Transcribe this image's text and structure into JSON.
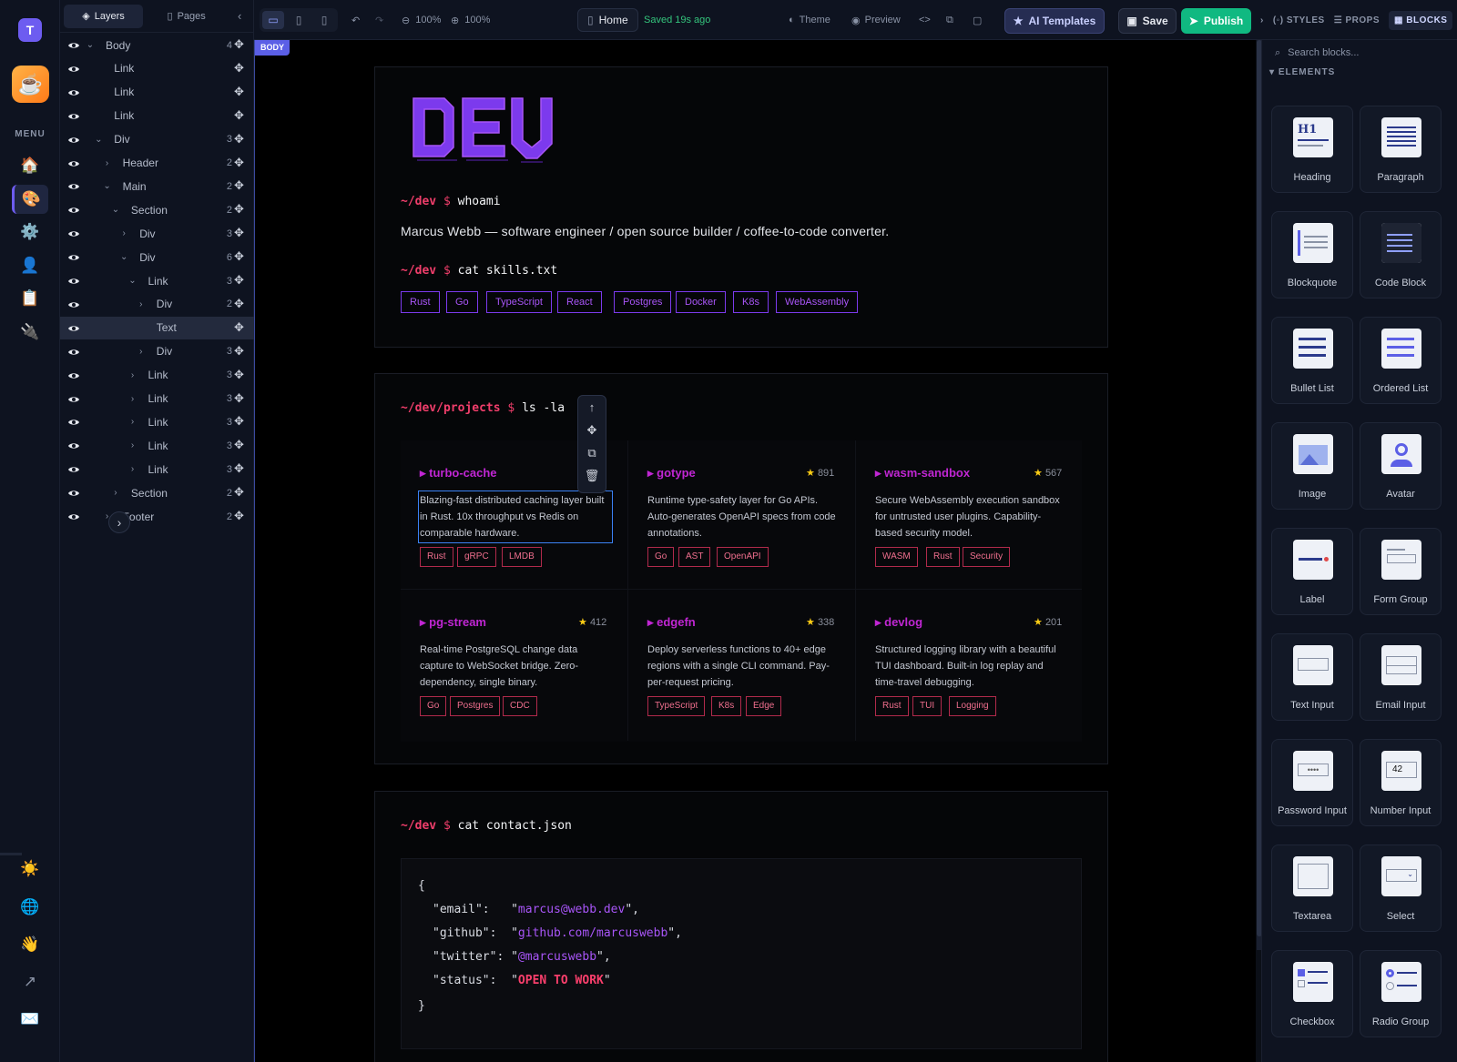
{
  "rail": {
    "logo": "T",
    "menu_label": "MENU",
    "items": [
      {
        "icon": "home-icon",
        "glyph": "🏠"
      },
      {
        "icon": "palette-icon",
        "glyph": "🎨"
      },
      {
        "icon": "gear-icon",
        "glyph": "⚙️"
      },
      {
        "icon": "user-icon",
        "glyph": "👤"
      },
      {
        "icon": "clipboard-icon",
        "glyph": "📋"
      },
      {
        "icon": "plug-icon",
        "glyph": "🔌"
      }
    ],
    "bottom": [
      {
        "icon": "sun-icon",
        "glyph": "☀️"
      },
      {
        "icon": "globe-icon",
        "glyph": "🌐"
      },
      {
        "icon": "wave-icon",
        "glyph": "👋"
      },
      {
        "icon": "external-arrow-icon",
        "glyph": "↗"
      },
      {
        "icon": "mail-icon",
        "glyph": "✉️"
      }
    ]
  },
  "layers_panel": {
    "tabs": {
      "layers": "Layers",
      "pages": "Pages"
    },
    "rows": [
      {
        "name": "Body",
        "depth": 0,
        "chev": "⌄",
        "count": "4"
      },
      {
        "name": "Link",
        "depth": 1,
        "chev": "",
        "count": ""
      },
      {
        "name": "Link",
        "depth": 1,
        "chev": "",
        "count": ""
      },
      {
        "name": "Link",
        "depth": 1,
        "chev": "",
        "count": ""
      },
      {
        "name": "Div",
        "depth": 1,
        "chev": "⌄",
        "count": "3"
      },
      {
        "name": "Header",
        "depth": 2,
        "chev": "›",
        "count": "2"
      },
      {
        "name": "Main",
        "depth": 2,
        "chev": "⌄",
        "count": "2"
      },
      {
        "name": "Section",
        "depth": 3,
        "chev": "⌄",
        "count": "2"
      },
      {
        "name": "Div",
        "depth": 4,
        "chev": "›",
        "count": "3"
      },
      {
        "name": "Div",
        "depth": 4,
        "chev": "⌄",
        "count": "6"
      },
      {
        "name": "Link",
        "depth": 5,
        "chev": "⌄",
        "count": "3"
      },
      {
        "name": "Div",
        "depth": 6,
        "chev": "›",
        "count": "2"
      },
      {
        "name": "Text",
        "depth": 6,
        "chev": "",
        "count": "",
        "selected": true
      },
      {
        "name": "Div",
        "depth": 6,
        "chev": "›",
        "count": "3"
      },
      {
        "name": "Link",
        "depth": 5,
        "chev": "›",
        "count": "3"
      },
      {
        "name": "Link",
        "depth": 5,
        "chev": "›",
        "count": "3"
      },
      {
        "name": "Link",
        "depth": 5,
        "chev": "›",
        "count": "3"
      },
      {
        "name": "Link",
        "depth": 5,
        "chev": "›",
        "count": "3"
      },
      {
        "name": "Link",
        "depth": 5,
        "chev": "›",
        "count": "3"
      },
      {
        "name": "Section",
        "depth": 3,
        "chev": "›",
        "count": "2"
      },
      {
        "name": "Footer",
        "depth": 2,
        "chev": "›",
        "count": "2"
      }
    ]
  },
  "toolbar": {
    "zoom_out": "100%",
    "zoom_in": "100%",
    "page_name": "Home",
    "saved_status": "Saved 19s ago",
    "theme": "Theme",
    "preview": "Preview",
    "ai_templates": "AI Templates",
    "save": "Save",
    "publish": "Publish",
    "right_tabs": {
      "styles": "STYLES",
      "props": "PROPS",
      "blocks": "BLOCKS"
    }
  },
  "blocks_panel": {
    "search_placeholder": "Search blocks...",
    "section_label": "ELEMENTS",
    "items": [
      {
        "label": "Heading",
        "icon": "heading-block-icon"
      },
      {
        "label": "Paragraph",
        "icon": "paragraph-block-icon"
      },
      {
        "label": "Blockquote",
        "icon": "blockquote-block-icon"
      },
      {
        "label": "Code Block",
        "icon": "code-block-icon"
      },
      {
        "label": "Bullet List",
        "icon": "bullet-list-icon"
      },
      {
        "label": "Ordered List",
        "icon": "ordered-list-icon"
      },
      {
        "label": "Image",
        "icon": "image-block-icon"
      },
      {
        "label": "Avatar",
        "icon": "avatar-block-icon"
      },
      {
        "label": "Label",
        "icon": "label-block-icon"
      },
      {
        "label": "Form Group",
        "icon": "form-group-icon"
      },
      {
        "label": "Text Input",
        "icon": "text-input-icon"
      },
      {
        "label": "Email Input",
        "icon": "email-input-icon"
      },
      {
        "label": "Password Input",
        "icon": "password-input-icon"
      },
      {
        "label": "Number Input",
        "icon": "number-input-icon",
        "value": "42"
      },
      {
        "label": "Textarea",
        "icon": "textarea-icon"
      },
      {
        "label": "Select",
        "icon": "select-icon"
      },
      {
        "label": "Checkbox",
        "icon": "checkbox-icon"
      },
      {
        "label": "Radio Group",
        "icon": "radio-group-icon"
      }
    ]
  },
  "canvas": {
    "body_tag": "BODY",
    "hero": {
      "logo_text": "DEV",
      "prompt1": {
        "path": "~/dev",
        "dollar": "$",
        "cmd": "whoami"
      },
      "bio": "Marcus Webb — software engineer / open source builder / coffee-to-code converter.",
      "prompt2": {
        "path": "~/dev",
        "dollar": "$",
        "cmd": "cat skills.txt"
      },
      "skills": [
        "Rust",
        "Go",
        "TypeScript",
        "React",
        "Postgres",
        "Docker",
        "K8s",
        "WebAssembly"
      ]
    },
    "projects": {
      "prompt": {
        "path": "~/dev/projects",
        "dollar": "$",
        "cmd": "ls -la"
      },
      "items": [
        {
          "name": "▸ turbo-cache",
          "stars": "",
          "desc": "Blazing-fast distributed caching layer built in Rust. 10x throughput vs Redis on comparable hardware.",
          "tags": [
            "Rust",
            "gRPC",
            "LMDB"
          ]
        },
        {
          "name": "▸ gotype",
          "stars": "891",
          "desc": "Runtime type-safety layer for Go APIs. Auto-generates OpenAPI specs from code annotations.",
          "tags": [
            "Go",
            "AST",
            "OpenAPI"
          ]
        },
        {
          "name": "▸ wasm-sandbox",
          "stars": "567",
          "desc": "Secure WebAssembly execution sandbox for untrusted user plugins. Capability-based security model.",
          "tags": [
            "WASM",
            "Rust",
            "Security"
          ]
        },
        {
          "name": "▸ pg-stream",
          "stars": "412",
          "desc": "Real-time PostgreSQL change data capture to WebSocket bridge. Zero-dependency, single binary.",
          "tags": [
            "Go",
            "Postgres",
            "CDC"
          ]
        },
        {
          "name": "▸ edgefn",
          "stars": "338",
          "desc": "Deploy serverless functions to 40+ edge regions with a single CLI command. Pay-per-request pricing.",
          "tags": [
            "TypeScript",
            "K8s",
            "Edge"
          ]
        },
        {
          "name": "▸ devlog",
          "stars": "201",
          "desc": "Structured logging library with a beautiful TUI dashboard. Built-in log replay and time-travel debugging.",
          "tags": [
            "Rust",
            "TUI",
            "Logging"
          ]
        }
      ]
    },
    "contact": {
      "prompt": {
        "path": "~/dev",
        "dollar": "$",
        "cmd": "cat contact.json"
      },
      "open_brace": "{",
      "close_brace": "}",
      "fields": [
        {
          "key": "\"email\":   \"",
          "value": "marcus@webb.dev",
          "end": "\","
        },
        {
          "key": "\"github\":  \"",
          "value": "github.com/marcuswebb",
          "end": "\","
        },
        {
          "key": "\"twitter\": \"",
          "value": "@marcuswebb",
          "end": "\","
        },
        {
          "key": "\"status\":  \"",
          "value": "OPEN TO WORK",
          "end": "\"",
          "highlight": true
        }
      ]
    }
  }
}
